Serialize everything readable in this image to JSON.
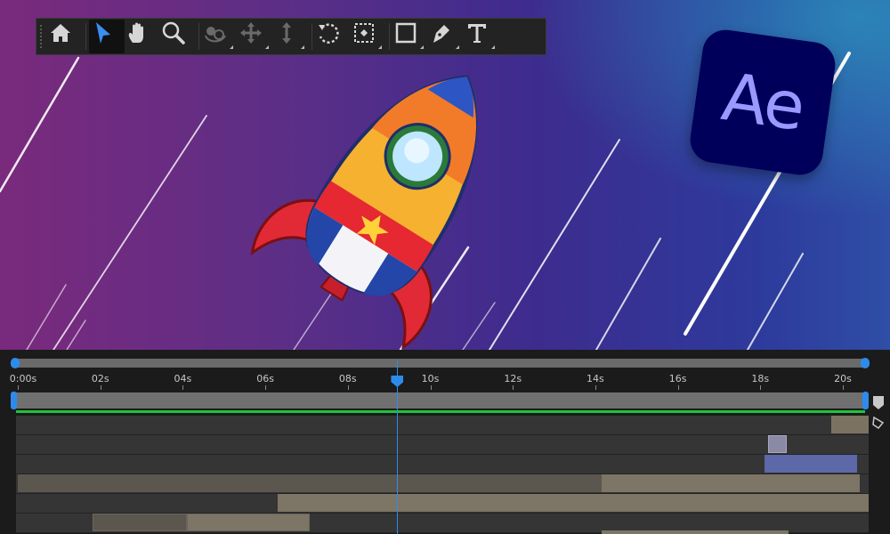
{
  "toolbar": {
    "tools": [
      {
        "name": "home-icon"
      },
      {
        "name": "selection-tool-icon",
        "active": true
      },
      {
        "name": "hand-tool-icon"
      },
      {
        "name": "zoom-tool-icon"
      },
      {
        "name": "orbit-camera-tool-icon",
        "disabled": true
      },
      {
        "name": "pan-camera-tool-icon",
        "disabled": true
      },
      {
        "name": "dolly-camera-tool-icon",
        "disabled": true
      },
      {
        "name": "rotation-tool-icon"
      },
      {
        "name": "pan-behind-tool-icon"
      },
      {
        "name": "rectangle-tool-icon"
      },
      {
        "name": "pen-tool-icon"
      },
      {
        "name": "type-tool-icon"
      }
    ]
  },
  "logo": {
    "text": "Ae",
    "bg": "#00005b",
    "fg": "#9999ff"
  },
  "timeline": {
    "ruler_labels": [
      "0:00s",
      "02s",
      "04s",
      "06s",
      "08s",
      "10s",
      "12s",
      "14s",
      "16s",
      "18s",
      "20s"
    ],
    "current_time_s": 9.2,
    "accent_color": "#2d8ceb",
    "work_area_color": "#1fc43a"
  },
  "colors": {
    "bg_left": "#7a2a7c",
    "bg_right": "#2f4ea6"
  }
}
